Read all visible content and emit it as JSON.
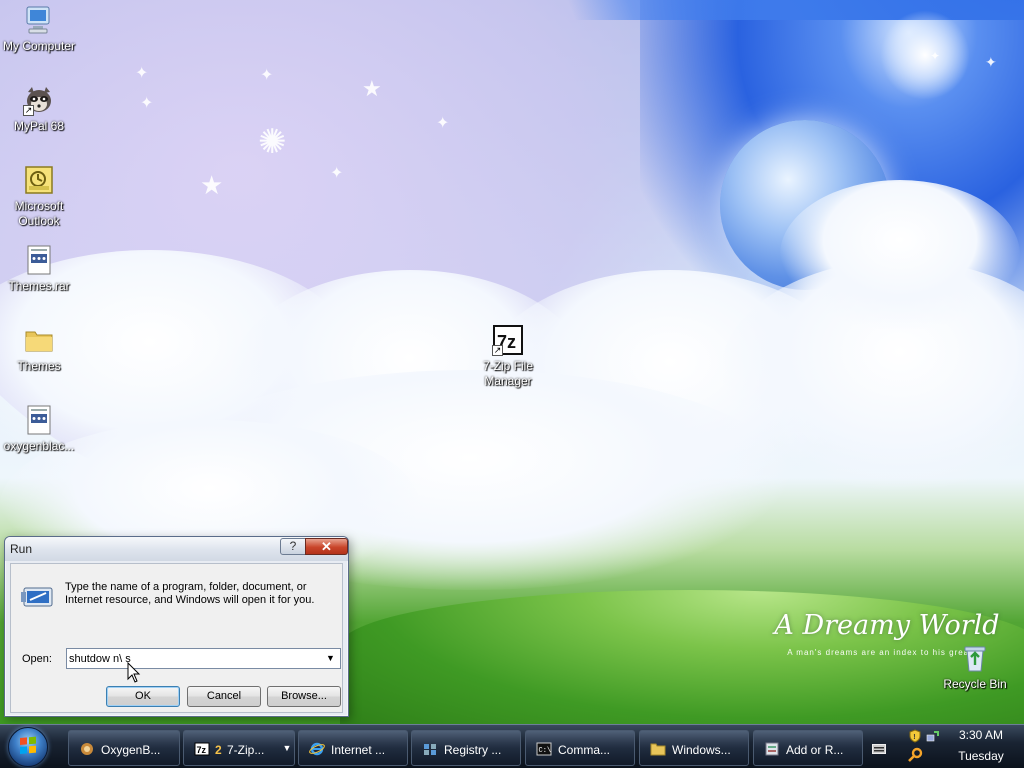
{
  "desktop": {
    "icons": [
      {
        "label": "My Computer",
        "icon": "computer-icon"
      },
      {
        "label": "MyPal 68",
        "icon": "mypal-raccoon-icon"
      },
      {
        "label": "Microsoft Outlook",
        "icon": "outlook-icon"
      },
      {
        "label": "Themes.rar",
        "icon": "rar-archive-icon"
      },
      {
        "label": "Themes",
        "icon": "folder-icon"
      },
      {
        "label": "oxygenblac...",
        "icon": "rar-archive-icon"
      },
      {
        "label": "7-Zip File Manager",
        "icon": "7zip-icon"
      },
      {
        "label": "Recycle Bin",
        "icon": "recycle-bin-icon"
      }
    ],
    "wallpaper": {
      "title": "A Dreamy World",
      "tagline": "A man's dreams are an index to his grea..."
    }
  },
  "run_dialog": {
    "title": "Run",
    "help_label": "?",
    "close_label": "✕",
    "description": "Type the name of a program, folder, document, or Internet resource, and Windows will open it for you.",
    "open_label": "Open:",
    "open_value": "shutdow n\\ s",
    "dropdown_glyph": "▼",
    "ok_label": "OK",
    "cancel_label": "Cancel",
    "browse_label": "Browse..."
  },
  "taskbar": {
    "buttons": [
      {
        "label": "OxygenB...",
        "icon": "oxygen-theme-icon"
      },
      {
        "label": "7-Zip...",
        "count": "2",
        "icon": "7zip-icon",
        "arrow": "▼"
      },
      {
        "label": "Internet ...",
        "icon": "internet-explorer-icon"
      },
      {
        "label": "Registry ...",
        "icon": "registry-editor-icon"
      },
      {
        "label": "Comma...",
        "icon": "command-prompt-icon"
      },
      {
        "label": "Windows...",
        "icon": "folder-icon"
      },
      {
        "label": "Add or R...",
        "icon": "add-remove-programs-icon"
      }
    ],
    "clock": {
      "time": "3:30 AM",
      "day": "Tuesday"
    }
  },
  "colors": {
    "accent_close": "#c9452a",
    "taskbar": "#0b121c",
    "dialog_bg": "#f0f0f0"
  }
}
